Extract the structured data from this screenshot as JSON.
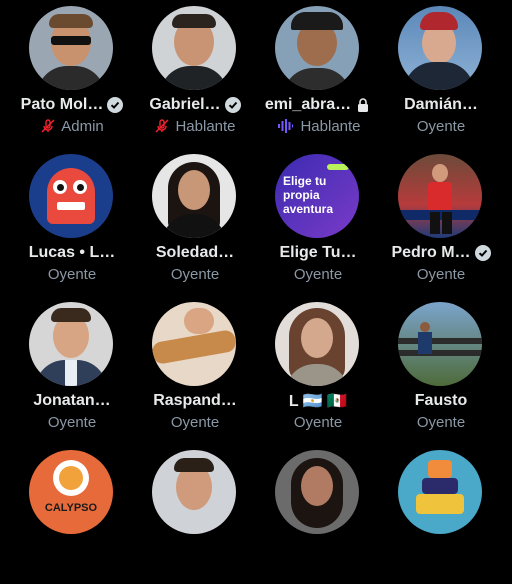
{
  "participants": [
    {
      "name": "Pato Mol…",
      "verified": true,
      "role": "Admin",
      "role_icon": "muted-mic-icon",
      "bg": "#9aa7b3",
      "face": "#c8926e"
    },
    {
      "name": "Gabriel…",
      "verified": true,
      "role": "Hablante",
      "role_icon": "muted-mic-icon",
      "bg": "#cfd3d6",
      "face": "#c99474"
    },
    {
      "name": "emi_abra…",
      "verified": false,
      "lock": true,
      "role": "Hablante",
      "role_icon": "speaking-waveform-icon",
      "bg": "#86a0b8",
      "face": "#9e6d4d"
    },
    {
      "name": "Damián…",
      "verified": false,
      "role": "Oyente",
      "role_icon": "",
      "bg": "#5b87b8",
      "face": "#d8a98e"
    },
    {
      "name": "Lucas • L…",
      "verified": false,
      "role": "Oyente",
      "role_icon": "",
      "bg": "#1b3e8c",
      "face": "#e94a3d"
    },
    {
      "name": "Soledad…",
      "verified": false,
      "role": "Oyente",
      "role_icon": "",
      "bg": "#e6e6e6",
      "face": "#c79778"
    },
    {
      "name": "Elige Tu…",
      "verified": false,
      "role": "Oyente",
      "role_icon": "",
      "bg": "#5630b8",
      "face": "",
      "avatar_text": "Elige tu propia aventura"
    },
    {
      "name": "Pedro M…",
      "verified": true,
      "role": "Oyente",
      "role_icon": "",
      "bg": "#b73b3b",
      "face": "#d19a7d"
    },
    {
      "name": "Jonatan…",
      "verified": false,
      "role": "Oyente",
      "role_icon": "",
      "bg": "#d6d6d6",
      "face": "#d7a584"
    },
    {
      "name": "Raspand…",
      "verified": false,
      "role": "Oyente",
      "role_icon": "",
      "bg": "#e8d8c8",
      "face": "#d4a15f"
    },
    {
      "name": "L 🇦🇷 🇲🇽",
      "verified": false,
      "role": "Oyente",
      "role_icon": "",
      "bg": "#e2ddd9",
      "face": "#d4a88c"
    },
    {
      "name": "Fausto",
      "verified": false,
      "role": "Oyente",
      "role_icon": "",
      "bg": "#7ba4cc",
      "face": "#8c5a3c"
    },
    {
      "name": "",
      "verified": false,
      "role": "",
      "role_icon": "",
      "bg": "#e76b3a",
      "face": "",
      "avatar_text": "CALYPSO"
    },
    {
      "name": "",
      "verified": false,
      "role": "",
      "role_icon": "",
      "bg": "#cfd2d6",
      "face": "#d09a7c"
    },
    {
      "name": "",
      "verified": false,
      "role": "",
      "role_icon": "",
      "bg": "#6b6b6b",
      "face": "#b07b62"
    },
    {
      "name": "",
      "verified": false,
      "role": "",
      "role_icon": "",
      "bg": "#4aa8c8",
      "face": "#f08c3c"
    }
  ]
}
